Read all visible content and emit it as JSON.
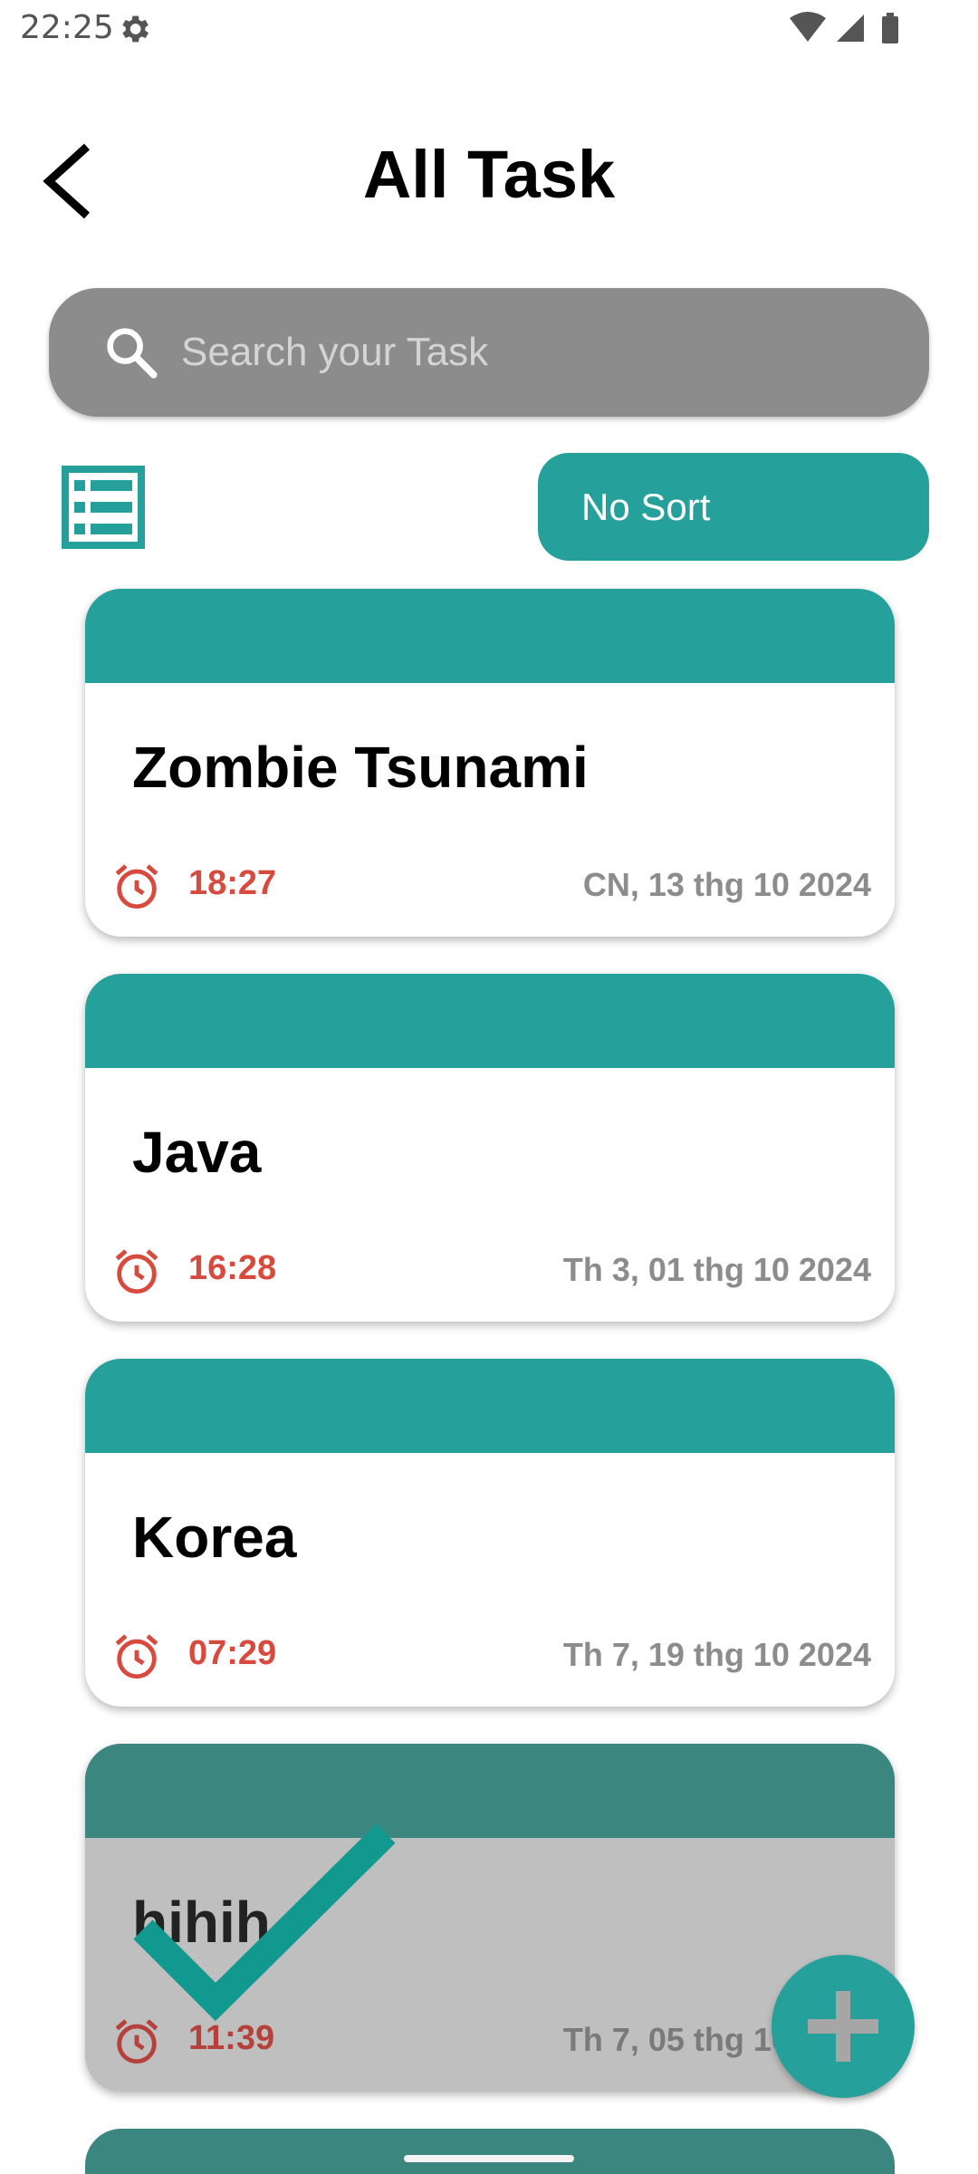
{
  "status_bar": {
    "time": "22:25"
  },
  "header": {
    "title": "All Task"
  },
  "search": {
    "placeholder": "Search your Task",
    "value": ""
  },
  "sort": {
    "label": "No Sort"
  },
  "colors": {
    "accent": "#26a09b",
    "accent_dark": "#3b8780",
    "search_bg": "#8c8c8c",
    "time_red": "#d84a3e",
    "completed_bg": "#bfbfbf"
  },
  "tasks": [
    {
      "title": "Zombie Tsunami",
      "time": "18:27",
      "date": "CN, 13 thg 10 2024",
      "completed": false
    },
    {
      "title": "Java",
      "time": "16:28",
      "date": "Th 3, 01 thg 10 2024",
      "completed": false
    },
    {
      "title": "Korea",
      "time": "07:29",
      "date": "Th 7, 19 thg 10 2024",
      "completed": false
    },
    {
      "title": "hihih",
      "time": "11:39",
      "date": "Th 7, 05 thg 10 2024",
      "completed": true
    }
  ],
  "icons": {
    "back": "arrow-back-icon",
    "search": "search-icon",
    "list_toggle": "list-view-icon",
    "alarm": "alarm-clock-icon",
    "done": "checkmark-icon",
    "add": "plus-icon"
  }
}
